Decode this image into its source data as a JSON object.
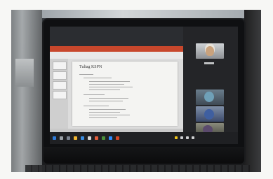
{
  "slide": {
    "title": "Tuliag KSPN"
  },
  "taskbar": {
    "tray_text": ""
  }
}
